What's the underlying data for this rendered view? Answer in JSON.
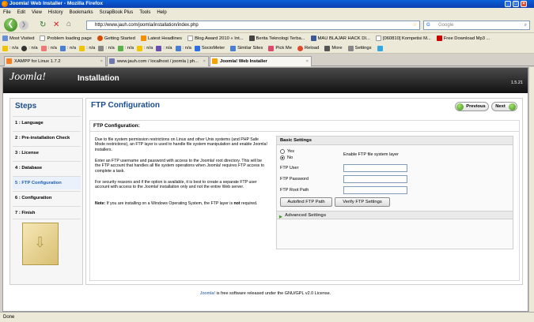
{
  "window": {
    "title": "Joomla! Web Installer - Mozilla Firefox"
  },
  "menu": [
    "File",
    "Edit",
    "View",
    "History",
    "Bookmarks",
    "ScrapBook Plus",
    "Tools",
    "Help"
  ],
  "nav": {
    "url": "http://www.jauh.com/joomla/installation/index.php",
    "search_placeholder": "Google"
  },
  "bookmarks_row1": [
    "Most Visited",
    "Problem loading page",
    "Getting Started",
    "Latest Headlines",
    "Blog Award 2010 « Int...",
    "Berita Teknologi Terba...",
    "MAU BLAJAR HACK DI...",
    "[060810] Kompetisi M...",
    "Free Download Mp3 ..."
  ],
  "bookmarks_row2": [
    ": n/a",
    ": n/a",
    ": n/a",
    ": n/a",
    ": n/a",
    ": n/a",
    ": n/a",
    ": n/a",
    ": n/a",
    ": n/a",
    "SocioMeter",
    "Similar Sites",
    "Pick Me",
    "Reload",
    "More",
    "Settings"
  ],
  "tabs": [
    "XAMPP for Linux 1.7.2",
    "www.jauh.com / localhost / joomla | ph...",
    "Joomla! Web Installer"
  ],
  "header": {
    "logo": "Joomla!",
    "title": "Installation",
    "version": "1.5.21"
  },
  "steps": {
    "title": "Steps",
    "items": [
      "1 : Language",
      "2 : Pre-installation Check",
      "3 : License",
      "4 : Database",
      "5 : FTP Configuration",
      "6 : Configuration",
      "7 : Finish"
    ]
  },
  "main": {
    "title": "FTP Configuration",
    "previous_label": "Previous",
    "next_label": "Next",
    "section_title": "FTP Configuration:",
    "para1": "Due to file system permission restrictions on Linux and other Unix systems (and PHP Safe Mode restrictions), an FTP layer is used to handle file system manipulation and enable Joomla! installers.",
    "para2": "Enter an FTP username and password with access to the Joomla! root directory. This will be the FTP account that handles all file system operations when Joomla! requires FTP access to complete a task.",
    "para3": "For security reasons and if the option is available, it is best to create a separate FTP user account with access to the Joomla! installation only and not the entire Web server.",
    "note_label": "Note:",
    "note_text_before": " If you are installing on a Windows Operating System, the FTP layer is ",
    "note_bold": "not",
    "note_text_after": " required.",
    "basic_settings": "Basic Settings",
    "yes_label": "Yes",
    "no_label": "No",
    "enable_label": "Enable FTP file system layer",
    "ftp_user_label": "FTP User",
    "ftp_password_label": "FTP Password",
    "ftp_root_label": "FTP Root Path",
    "ftp_user_value": "",
    "ftp_password_value": "",
    "ftp_root_value": "",
    "autofind_label": "Autofind FTP Path",
    "verify_label": "Verify FTP Settings",
    "advanced_label": "Advanced Settings"
  },
  "footer": {
    "link": "Joomla!",
    "text": " is free software released under the GNU/GPL v2.0 License."
  },
  "status": "Done"
}
